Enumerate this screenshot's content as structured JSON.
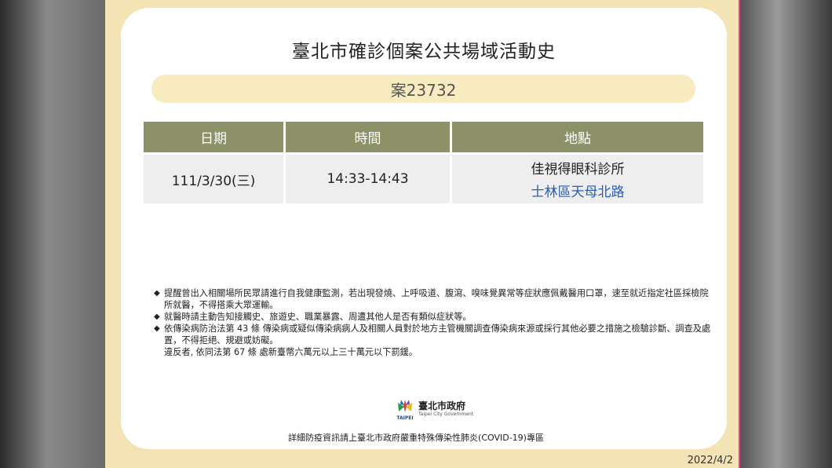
{
  "title": "臺北市確診個案公共場域活動史",
  "case_label": "案23732",
  "table": {
    "headers": [
      "日期",
      "時間",
      "地點"
    ],
    "rows": [
      {
        "date": "111/3/30(三)",
        "time": "14:33-14:43",
        "location_name": "佳視得眼科診所",
        "location_area": "士林區天母北路"
      }
    ]
  },
  "notes": [
    "提醒曾出入相關場所民眾請進行自我健康監測，若出現發燒、上呼吸道、腹瀉、嗅味覺異常等症狀應佩戴醫用口罩，速至就近指定社區採檢院所就醫，不得搭乘大眾運輸。",
    "就醫時請主動告知接觸史、旅遊史、職業暴露、周遭其他人是否有類似症狀等。",
    "依傳染病防治法第 43 條 傳染病或疑似傳染病病人及相關人員對於地方主管機關調查傳染病來源或採行其他必要之措施之檢驗診斷、調查及處置，不得拒絕、規避或妨礙。"
  ],
  "note_extra": "違反者, 依同法第 67 條 處新臺幣六萬元以上三十萬元以下罰鍰。",
  "logo": {
    "mark_text": "TAIPEI",
    "name_zh": "臺北市政府",
    "name_en": "Taipei City Government"
  },
  "footer": "詳細防疫資訊請上臺北市政府嚴重特殊傳染性肺炎(COVID-19)專區",
  "date_stamp": "2022/4/2",
  "colors": {
    "frame": "#f3e3b5",
    "pill": "#f8ebbf",
    "header": "#8d9168",
    "cell": "#eeeeee",
    "link_blue": "#2a5db5"
  }
}
